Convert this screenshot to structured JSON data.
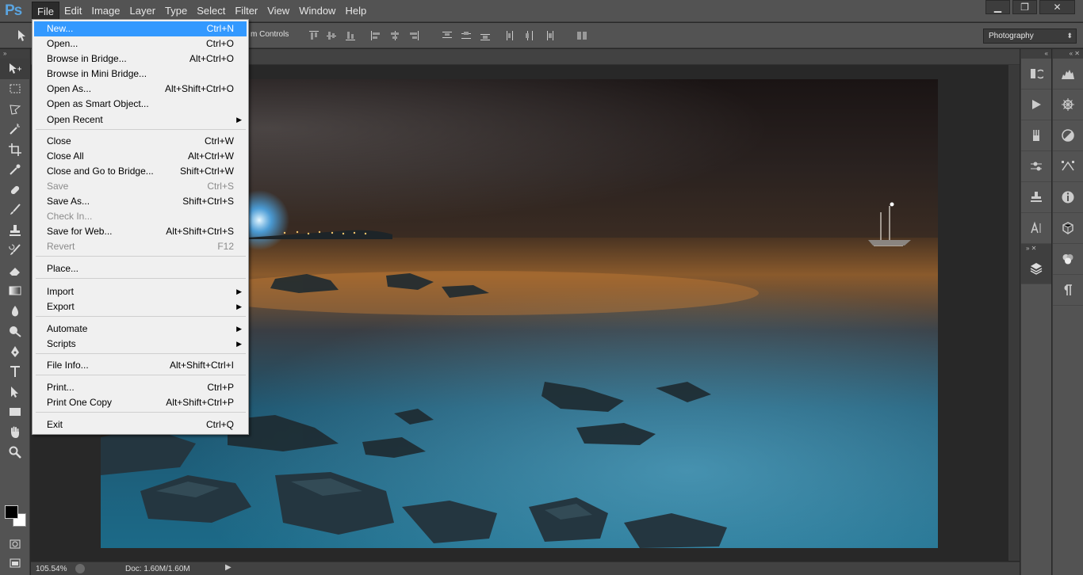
{
  "app": {
    "logo": "Ps"
  },
  "menubar": {
    "items": [
      "File",
      "Edit",
      "Image",
      "Layer",
      "Type",
      "Select",
      "Filter",
      "View",
      "Window",
      "Help"
    ],
    "active": "File",
    "window_controls": [
      "minimize-icon",
      "restore-icon",
      "close-icon"
    ]
  },
  "options_bar": {
    "label": "m Controls",
    "workspace": "Photography"
  },
  "file_menu": {
    "items": [
      {
        "label": "New...",
        "shortcut": "Ctrl+N",
        "state": "selected"
      },
      {
        "label": "Open...",
        "shortcut": "Ctrl+O",
        "state": "enabled"
      },
      {
        "label": "Browse in Bridge...",
        "shortcut": "Alt+Ctrl+O",
        "state": "enabled"
      },
      {
        "label": "Browse in Mini Bridge...",
        "shortcut": "",
        "state": "enabled"
      },
      {
        "label": "Open As...",
        "shortcut": "Alt+Shift+Ctrl+O",
        "state": "enabled"
      },
      {
        "label": "Open as Smart Object...",
        "shortcut": "",
        "state": "enabled"
      },
      {
        "label": "Open Recent",
        "shortcut": "",
        "state": "enabled",
        "submenu": true
      },
      {
        "label": "Close",
        "shortcut": "Ctrl+W",
        "state": "enabled"
      },
      {
        "label": "Close All",
        "shortcut": "Alt+Ctrl+W",
        "state": "enabled"
      },
      {
        "label": "Close and Go to Bridge...",
        "shortcut": "Shift+Ctrl+W",
        "state": "enabled"
      },
      {
        "label": "Save",
        "shortcut": "Ctrl+S",
        "state": "disabled"
      },
      {
        "label": "Save As...",
        "shortcut": "Shift+Ctrl+S",
        "state": "enabled"
      },
      {
        "label": "Check In...",
        "shortcut": "",
        "state": "disabled"
      },
      {
        "label": "Save for Web...",
        "shortcut": "Alt+Shift+Ctrl+S",
        "state": "enabled"
      },
      {
        "label": "Revert",
        "shortcut": "F12",
        "state": "disabled"
      },
      {
        "label": "Place...",
        "shortcut": "",
        "state": "enabled"
      },
      {
        "label": "Import",
        "shortcut": "",
        "state": "enabled",
        "submenu": true
      },
      {
        "label": "Export",
        "shortcut": "",
        "state": "enabled",
        "submenu": true
      },
      {
        "label": "Automate",
        "shortcut": "",
        "state": "enabled",
        "submenu": true
      },
      {
        "label": "Scripts",
        "shortcut": "",
        "state": "enabled",
        "submenu": true
      },
      {
        "label": "File Info...",
        "shortcut": "Alt+Shift+Ctrl+I",
        "state": "enabled"
      },
      {
        "label": "Print...",
        "shortcut": "Ctrl+P",
        "state": "enabled"
      },
      {
        "label": "Print One Copy",
        "shortcut": "Alt+Shift+Ctrl+P",
        "state": "enabled"
      },
      {
        "label": "Exit",
        "shortcut": "Ctrl+Q",
        "state": "enabled"
      }
    ]
  },
  "status": {
    "zoom": "105.54%",
    "doc": "Doc: 1.60M/1.60M"
  },
  "tools": [
    "move-icon",
    "marquee-icon",
    "lasso-icon",
    "magic-wand-icon",
    "crop-icon",
    "eyedropper-icon",
    "healing-brush-icon",
    "brush-icon",
    "clone-stamp-icon",
    "history-brush-icon",
    "eraser-icon",
    "gradient-icon",
    "blur-icon",
    "dodge-icon",
    "pen-icon",
    "type-icon",
    "path-selection-icon",
    "rectangle-icon",
    "hand-icon",
    "zoom-icon"
  ],
  "colors": {
    "foreground": "#000000",
    "background": "#ffffff",
    "menu_highlight": "#3399ff"
  }
}
